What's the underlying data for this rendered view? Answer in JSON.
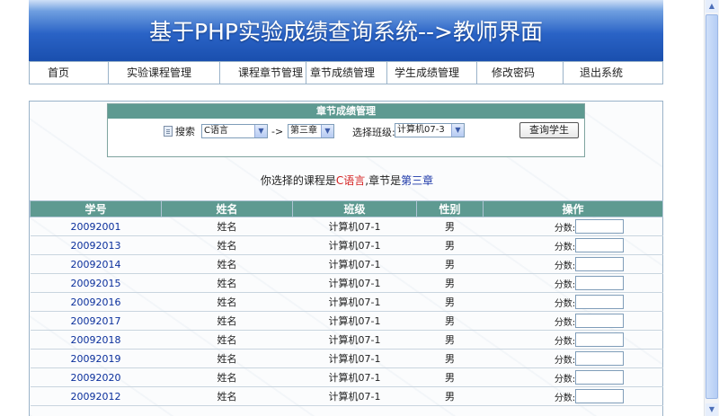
{
  "header": {
    "title": "基于PHP实验成绩查询系统-->教师界面"
  },
  "nav": {
    "items": [
      {
        "label": "首页"
      },
      {
        "label": "实验课程管理"
      },
      {
        "label": "课程章节管理"
      },
      {
        "label": "章节成绩管理"
      },
      {
        "label": "学生成绩管理"
      },
      {
        "label": "修改密码"
      },
      {
        "label": "退出系统"
      }
    ]
  },
  "panel": {
    "title": "章节成绩管理",
    "search_label": "搜索",
    "course_value": "C语言",
    "separator": "->",
    "chapter_value": "第三章",
    "class_label": "选择班级:",
    "class_value": "计算机07-3",
    "query_button": "查询学生"
  },
  "selection_info": {
    "prefix": "你选择的课程是",
    "course": "C语言",
    "middle": ",章节是",
    "chapter": "第三章"
  },
  "table": {
    "headers": {
      "id": "学号",
      "name": "姓名",
      "class": "班级",
      "gender": "性别",
      "action": "操作"
    },
    "score_label": "分数:",
    "rows": [
      {
        "id": "20092001",
        "name": "姓名",
        "class": "计算机07-1",
        "gender": "男"
      },
      {
        "id": "20092013",
        "name": "姓名",
        "class": "计算机07-1",
        "gender": "男"
      },
      {
        "id": "20092014",
        "name": "姓名",
        "class": "计算机07-1",
        "gender": "男"
      },
      {
        "id": "20092015",
        "name": "姓名",
        "class": "计算机07-1",
        "gender": "男"
      },
      {
        "id": "20092016",
        "name": "姓名",
        "class": "计算机07-1",
        "gender": "男"
      },
      {
        "id": "20092017",
        "name": "姓名",
        "class": "计算机07-1",
        "gender": "男"
      },
      {
        "id": "20092018",
        "name": "姓名",
        "class": "计算机07-1",
        "gender": "男"
      },
      {
        "id": "20092019",
        "name": "姓名",
        "class": "计算机07-1",
        "gender": "男"
      },
      {
        "id": "20092020",
        "name": "姓名",
        "class": "计算机07-1",
        "gender": "男"
      },
      {
        "id": "20092012",
        "name": "姓名",
        "class": "计算机07-1",
        "gender": "男"
      }
    ]
  },
  "colors": {
    "banner_blue": "#2a63c6",
    "table_header": "#5e9a91",
    "course_red": "#d42020",
    "chapter_blue": "#1c37a8",
    "student_id_blue": "#0a2f9c"
  }
}
